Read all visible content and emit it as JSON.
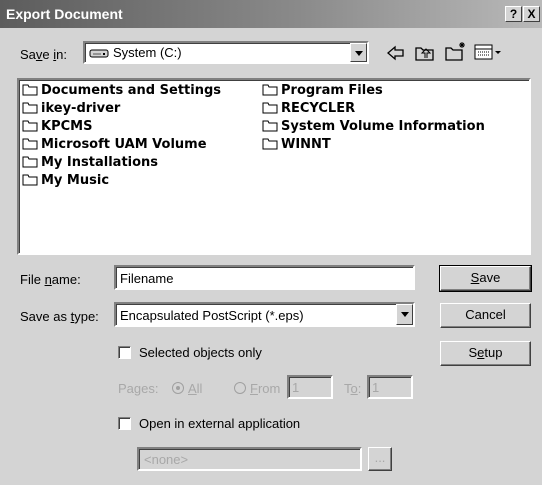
{
  "window": {
    "title": "Export Document",
    "help_btn": "?",
    "close_btn": "X"
  },
  "save_in": {
    "label": "Save in:",
    "value": "System (C:)"
  },
  "toolbar": {
    "icons": [
      "back-icon",
      "up-folder-icon",
      "new-folder-icon",
      "view-menu-icon"
    ]
  },
  "folders": [
    "Documents and Settings",
    "ikey-driver",
    "KPCMS",
    "Microsoft UAM Volume",
    "My Installations",
    "My Music",
    "Program Files",
    "RECYCLER",
    "System Volume Information",
    "WINNT"
  ],
  "file_name": {
    "label": "File name:",
    "value": "Filename"
  },
  "save_as_type": {
    "label": "Save as type:",
    "value": "Encapsulated PostScript (*.eps)"
  },
  "buttons": {
    "save": "Save",
    "cancel": "Cancel",
    "setup": "Setup",
    "browse": "..."
  },
  "options": {
    "selected_only": "Selected objects only",
    "pages_label": "Pages:",
    "all": "All",
    "from": "From",
    "from_value": "1",
    "to": "To:",
    "to_value": "1",
    "open_external": "Open in external application",
    "app_value": "<none>"
  },
  "colors": {
    "face": "#d4d4d4",
    "title_start": "#5c5c5c",
    "title_end": "#b9b9b9"
  }
}
